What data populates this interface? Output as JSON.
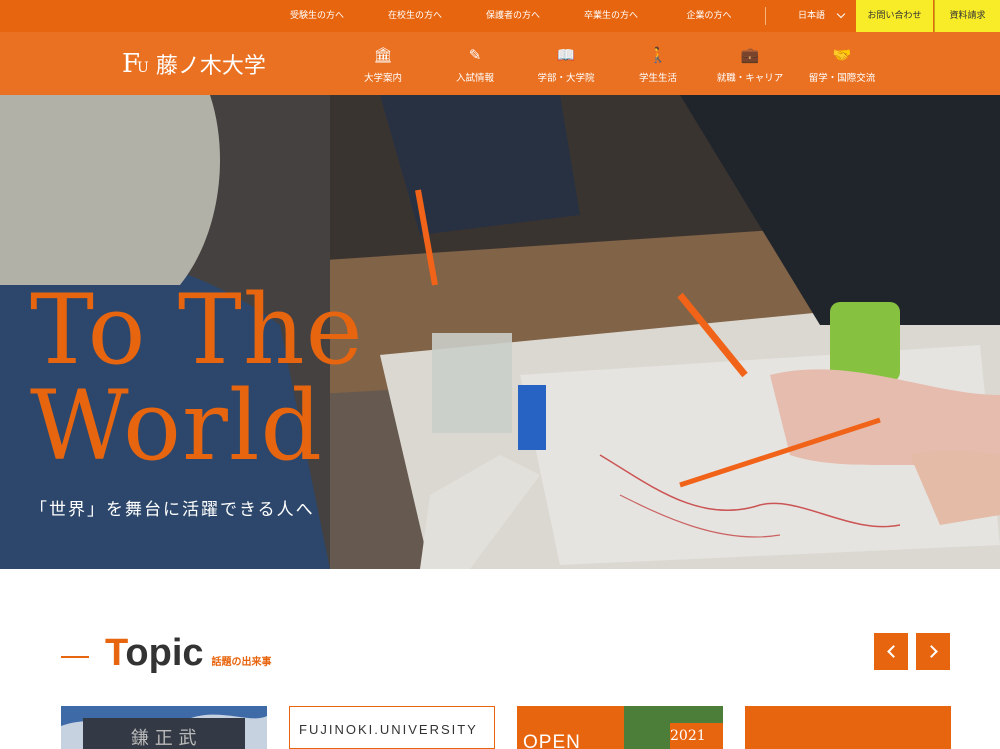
{
  "topbar": {
    "links": [
      "受験生の方へ",
      "在校生の方へ",
      "保護者の方へ",
      "卒業生の方へ",
      "企業の方へ"
    ],
    "language": "日本語",
    "contact_label": "お問い合わせ",
    "brochure_label": "資料請求"
  },
  "brand": {
    "mark_f": "F",
    "mark_u": "U",
    "name": "藤ノ木大学"
  },
  "nav": [
    {
      "icon": "building-icon",
      "glyph": "🏛",
      "label": "大学案内"
    },
    {
      "icon": "pen-icon",
      "glyph": "✎",
      "label": "入試情報"
    },
    {
      "icon": "book-icon",
      "glyph": "📖",
      "label": "学部・大学院"
    },
    {
      "icon": "walking-person-icon",
      "glyph": "🚶",
      "label": "学生生活"
    },
    {
      "icon": "briefcase-icon",
      "glyph": "💼",
      "label": "就職・キャリア"
    },
    {
      "icon": "handshake-icon",
      "glyph": "🤝",
      "label": "留学・国際交流"
    }
  ],
  "hero": {
    "line1": "To The",
    "line2": "World",
    "tagline": "「世界」を舞台に活躍できる人へ"
  },
  "topic": {
    "title_first": "T",
    "title_rest": "opic",
    "subtitle": "話題の出来事"
  },
  "cards": [
    {
      "text": ""
    },
    {
      "text": "FUJINOKI.UNIVERSITY"
    },
    {
      "text": "OPEN",
      "year": "2021"
    },
    {
      "text": ""
    }
  ],
  "colors": {
    "brand": "#e8650f",
    "accent": "#f7ec27"
  }
}
